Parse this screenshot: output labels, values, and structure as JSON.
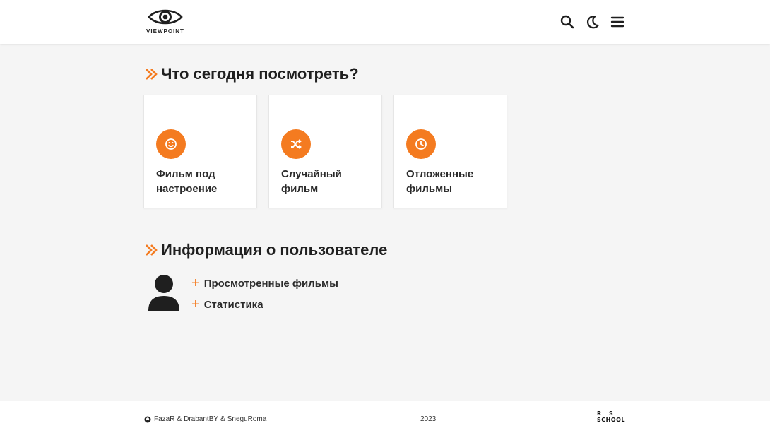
{
  "header": {
    "logo_text": "VIEWPOINT"
  },
  "colors": {
    "accent": "#f47b20",
    "text": "#1f1f1f",
    "background": "#f5f5f5"
  },
  "watch_section": {
    "title": "Что сегодня посмотреть?",
    "cards": [
      {
        "label": "Фильм под настроение",
        "icon": "smile-icon"
      },
      {
        "label": "Случайный фильм",
        "icon": "shuffle-icon"
      },
      {
        "label": "Отложенные фильмы",
        "icon": "clock-icon"
      }
    ]
  },
  "user_section": {
    "title": "Информация о пользователе",
    "links": [
      {
        "label": "Просмотренные фильмы"
      },
      {
        "label": "Статистика"
      }
    ]
  },
  "footer": {
    "authors": [
      "FazaR",
      "DrabantBY",
      "SneguRoma"
    ],
    "separator": "&",
    "year": "2023",
    "school_logo_top": "R S",
    "school_logo_bottom": "SCHOOL"
  }
}
